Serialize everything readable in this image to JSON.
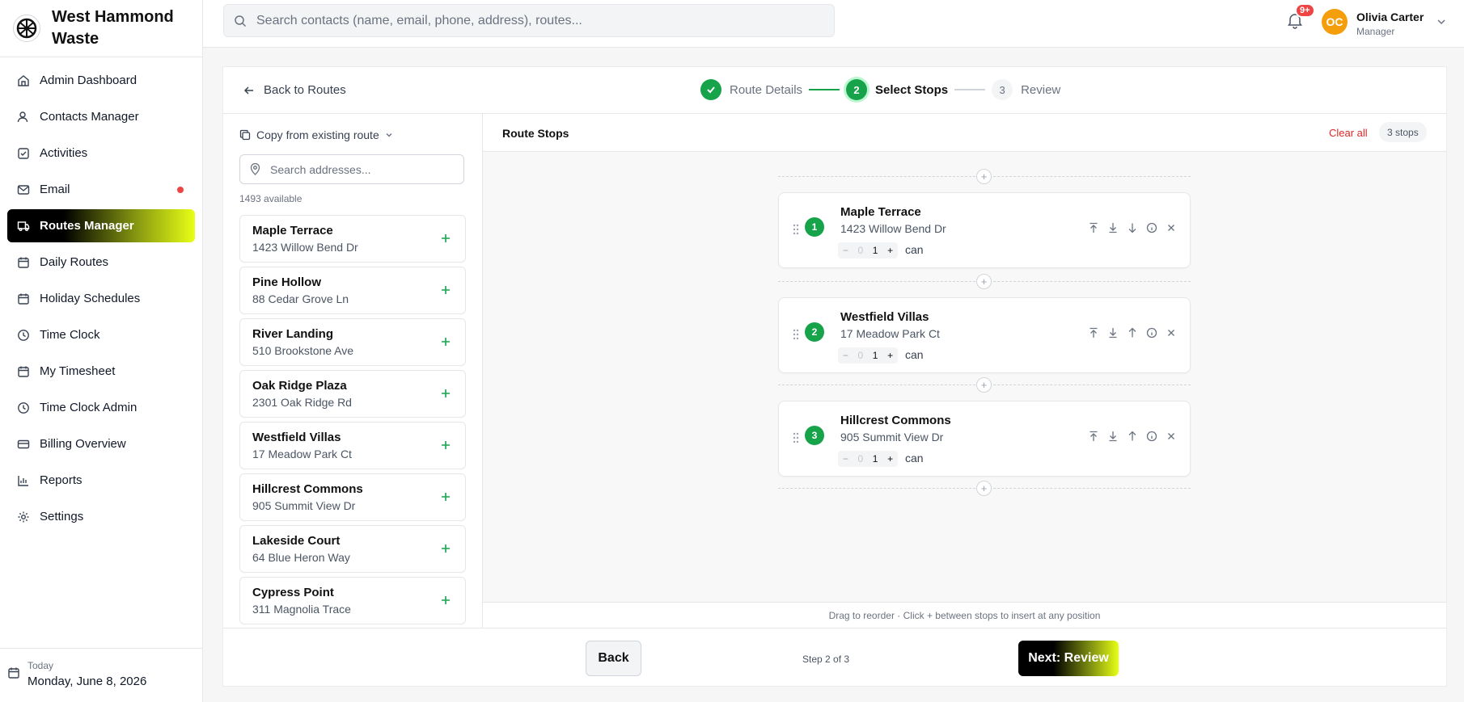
{
  "brand": {
    "name": "West Hammond Waste"
  },
  "sidebar": {
    "items": [
      {
        "label": "Admin Dashboard",
        "icon": "home-icon",
        "active": false
      },
      {
        "label": "Contacts Manager",
        "icon": "user-icon",
        "active": false
      },
      {
        "label": "Activities",
        "icon": "checkbox-icon",
        "active": false
      },
      {
        "label": "Email",
        "icon": "mail-icon",
        "active": false,
        "dot": true
      },
      {
        "label": "Routes Manager",
        "icon": "truck-icon",
        "active": true
      },
      {
        "label": "Daily Routes",
        "icon": "calendar-icon",
        "active": false
      },
      {
        "label": "Holiday Schedules",
        "icon": "calendar-icon",
        "active": false
      },
      {
        "label": "Time Clock",
        "icon": "clock-icon",
        "active": false
      },
      {
        "label": "My Timesheet",
        "icon": "calendar-icon",
        "active": false
      },
      {
        "label": "Time Clock Admin",
        "icon": "clock-icon",
        "active": false
      },
      {
        "label": "Billing Overview",
        "icon": "credit-card-icon",
        "active": false
      },
      {
        "label": "Reports",
        "icon": "bar-chart-icon",
        "active": false
      },
      {
        "label": "Settings",
        "icon": "gear-icon",
        "active": false
      }
    ],
    "today_label": "Today",
    "today_date": "Monday, June 8, 2026"
  },
  "topbar": {
    "search_placeholder": "Search contacts (name, email, phone, address), routes...",
    "notification_badge": "9+",
    "user_initials": "OC",
    "user_name": "Olivia Carter",
    "user_role": "Manager"
  },
  "wizard": {
    "back_link": "Back to Routes",
    "steps": [
      {
        "label": "Route Details",
        "state": "done",
        "number": ""
      },
      {
        "label": "Select Stops",
        "state": "current",
        "number": "2"
      },
      {
        "label": "Review",
        "state": "todo",
        "number": "3"
      }
    ]
  },
  "left_pane": {
    "copy_route_label": "Copy from existing route",
    "search_placeholder": "Search addresses...",
    "available_text": "1493 available",
    "addresses": [
      {
        "name": "Maple Terrace",
        "street": "1423 Willow Bend Dr"
      },
      {
        "name": "Pine Hollow",
        "street": "88 Cedar Grove Ln"
      },
      {
        "name": "River Landing",
        "street": "510 Brookstone Ave"
      },
      {
        "name": "Oak Ridge Plaza",
        "street": "2301 Oak Ridge Rd"
      },
      {
        "name": "Westfield Villas",
        "street": "17 Meadow Park Ct"
      },
      {
        "name": "Hillcrest Commons",
        "street": "905 Summit View Dr"
      },
      {
        "name": "Lakeside Court",
        "street": "64 Blue Heron Way"
      },
      {
        "name": "Cypress Point",
        "street": "311 Magnolia Trace"
      }
    ]
  },
  "right_pane": {
    "title": "Route Stops",
    "clear_all": "Clear all",
    "stop_count": "3 stops",
    "stops": [
      {
        "number": "1",
        "name": "Maple Terrace",
        "street": "1423 Willow Bend Dr",
        "qty_minus": "−",
        "qty_ghost": "0",
        "qty_value": "1",
        "qty_plus": "+",
        "unit": "can"
      },
      {
        "number": "2",
        "name": "Westfield Villas",
        "street": "17 Meadow Park Ct",
        "qty_minus": "−",
        "qty_ghost": "0",
        "qty_value": "1",
        "qty_plus": "+",
        "unit": "can"
      },
      {
        "number": "3",
        "name": "Hillcrest Commons",
        "street": "905 Summit View Dr",
        "qty_minus": "−",
        "qty_ghost": "0",
        "qty_value": "1",
        "qty_plus": "+",
        "unit": "can"
      }
    ],
    "footer_hint": "Drag to reorder · Click + between stops to insert at any position"
  },
  "footer": {
    "back_label": "Back",
    "step_of": "Step 2 of 3",
    "next_label": "Next: Review"
  },
  "colors": {
    "accent_green": "#16a34a",
    "danger_red": "#dc2626",
    "avatar_orange": "#f59e0b",
    "active_gradient_end": "#e8ff14"
  }
}
